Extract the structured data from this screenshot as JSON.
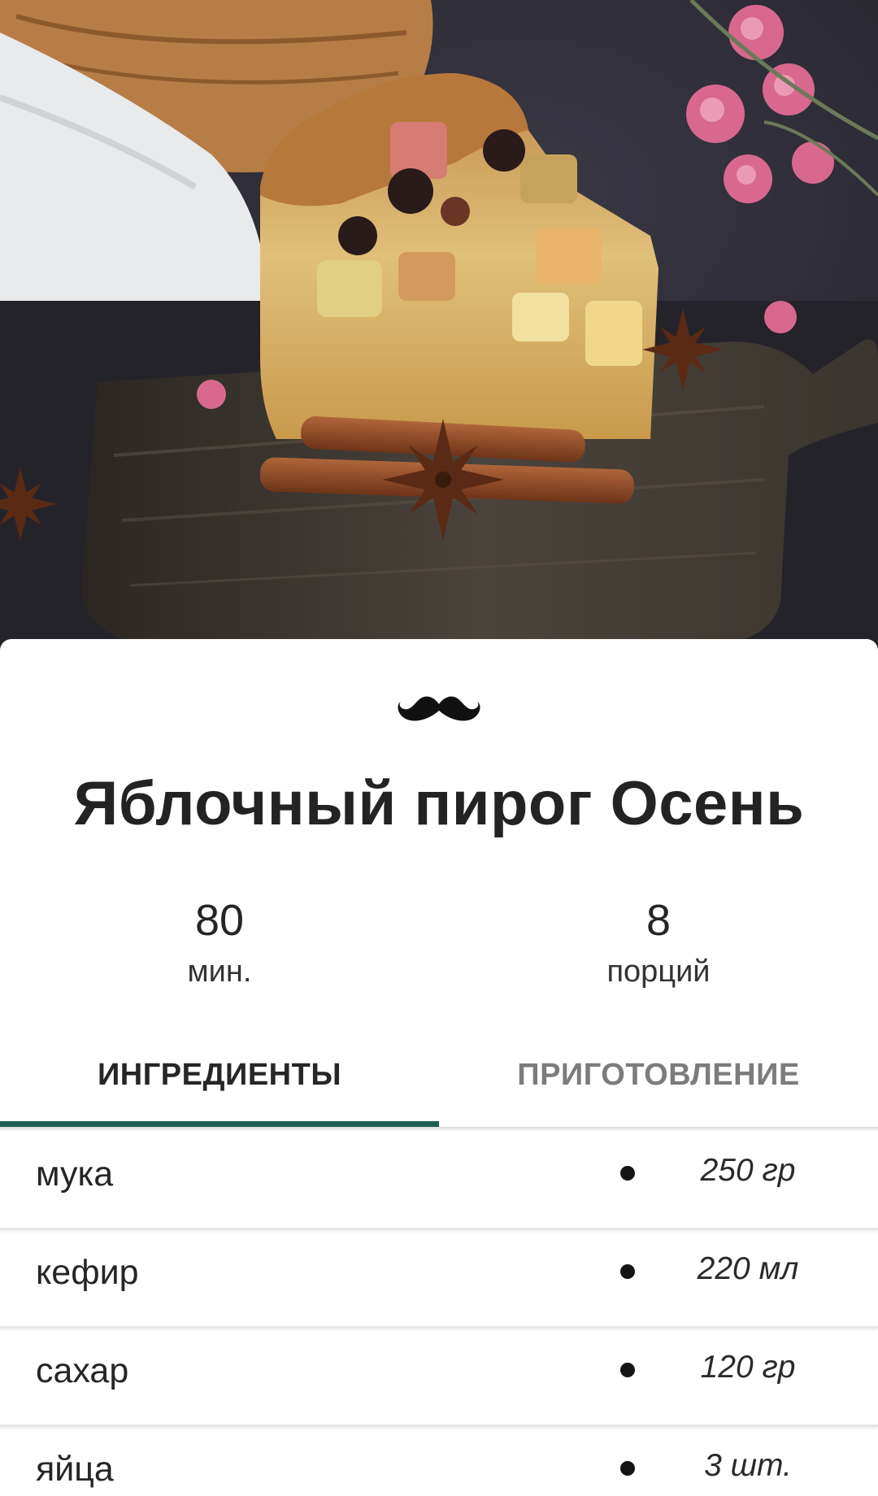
{
  "recipe": {
    "title": "Яблочный пирог Осень",
    "time_value": "80",
    "time_unit": "мин.",
    "portions_value": "8",
    "portions_unit": "порций"
  },
  "tabs": [
    {
      "label": "ИНГРЕДИЕНТЫ",
      "active": true
    },
    {
      "label": "ПРИГОТОВЛЕНИЕ",
      "active": false
    }
  ],
  "ingredients": [
    {
      "name": "мука",
      "amount": "250 гр"
    },
    {
      "name": "кефир",
      "amount": "220 мл"
    },
    {
      "name": "сахар",
      "amount": "120 гр"
    },
    {
      "name": "яйца",
      "amount": "3 шт."
    }
  ],
  "icons": {
    "logo": "mustache-icon"
  },
  "colors": {
    "tab_indicator": "#1d5f53",
    "active_tab_text": "#262626",
    "inactive_tab_text": "#7c7c7c"
  }
}
